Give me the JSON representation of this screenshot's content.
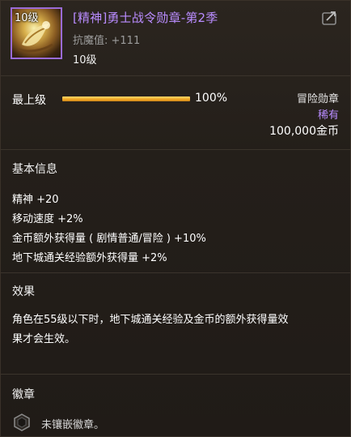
{
  "item": {
    "level_overlay": "10级",
    "title": "[精神]勇士战令勋章-第2季",
    "stat": "抗魔值: +111",
    "level": "10级"
  },
  "grade": {
    "label": "最上级",
    "percent_text": "100%",
    "percent_value": 100
  },
  "meta": {
    "type": "冒险勋章",
    "rarity": "稀有",
    "price": "100,000金币"
  },
  "basic_info": {
    "title": "基本信息",
    "attributes": [
      "精神 +20",
      "移动速度 +2%",
      "金币额外获得量 ( 剧情普通/冒险 ) +10%",
      "地下城通关经验额外获得量 +2%"
    ]
  },
  "effect": {
    "title": "效果",
    "description_lines": [
      "角色在55级以下时，地下城通关经验及金币的额外获得量效",
      "果才会生效。"
    ]
  },
  "emblem": {
    "title": "徽章",
    "slot_text": "未镶嵌徽章。"
  },
  "colors": {
    "rarity": "#b98cff",
    "bar": "#f2a823",
    "background": "#231e19"
  },
  "icons": {
    "share": "share-icon",
    "emblem_slot": "emblem-slot-icon"
  }
}
